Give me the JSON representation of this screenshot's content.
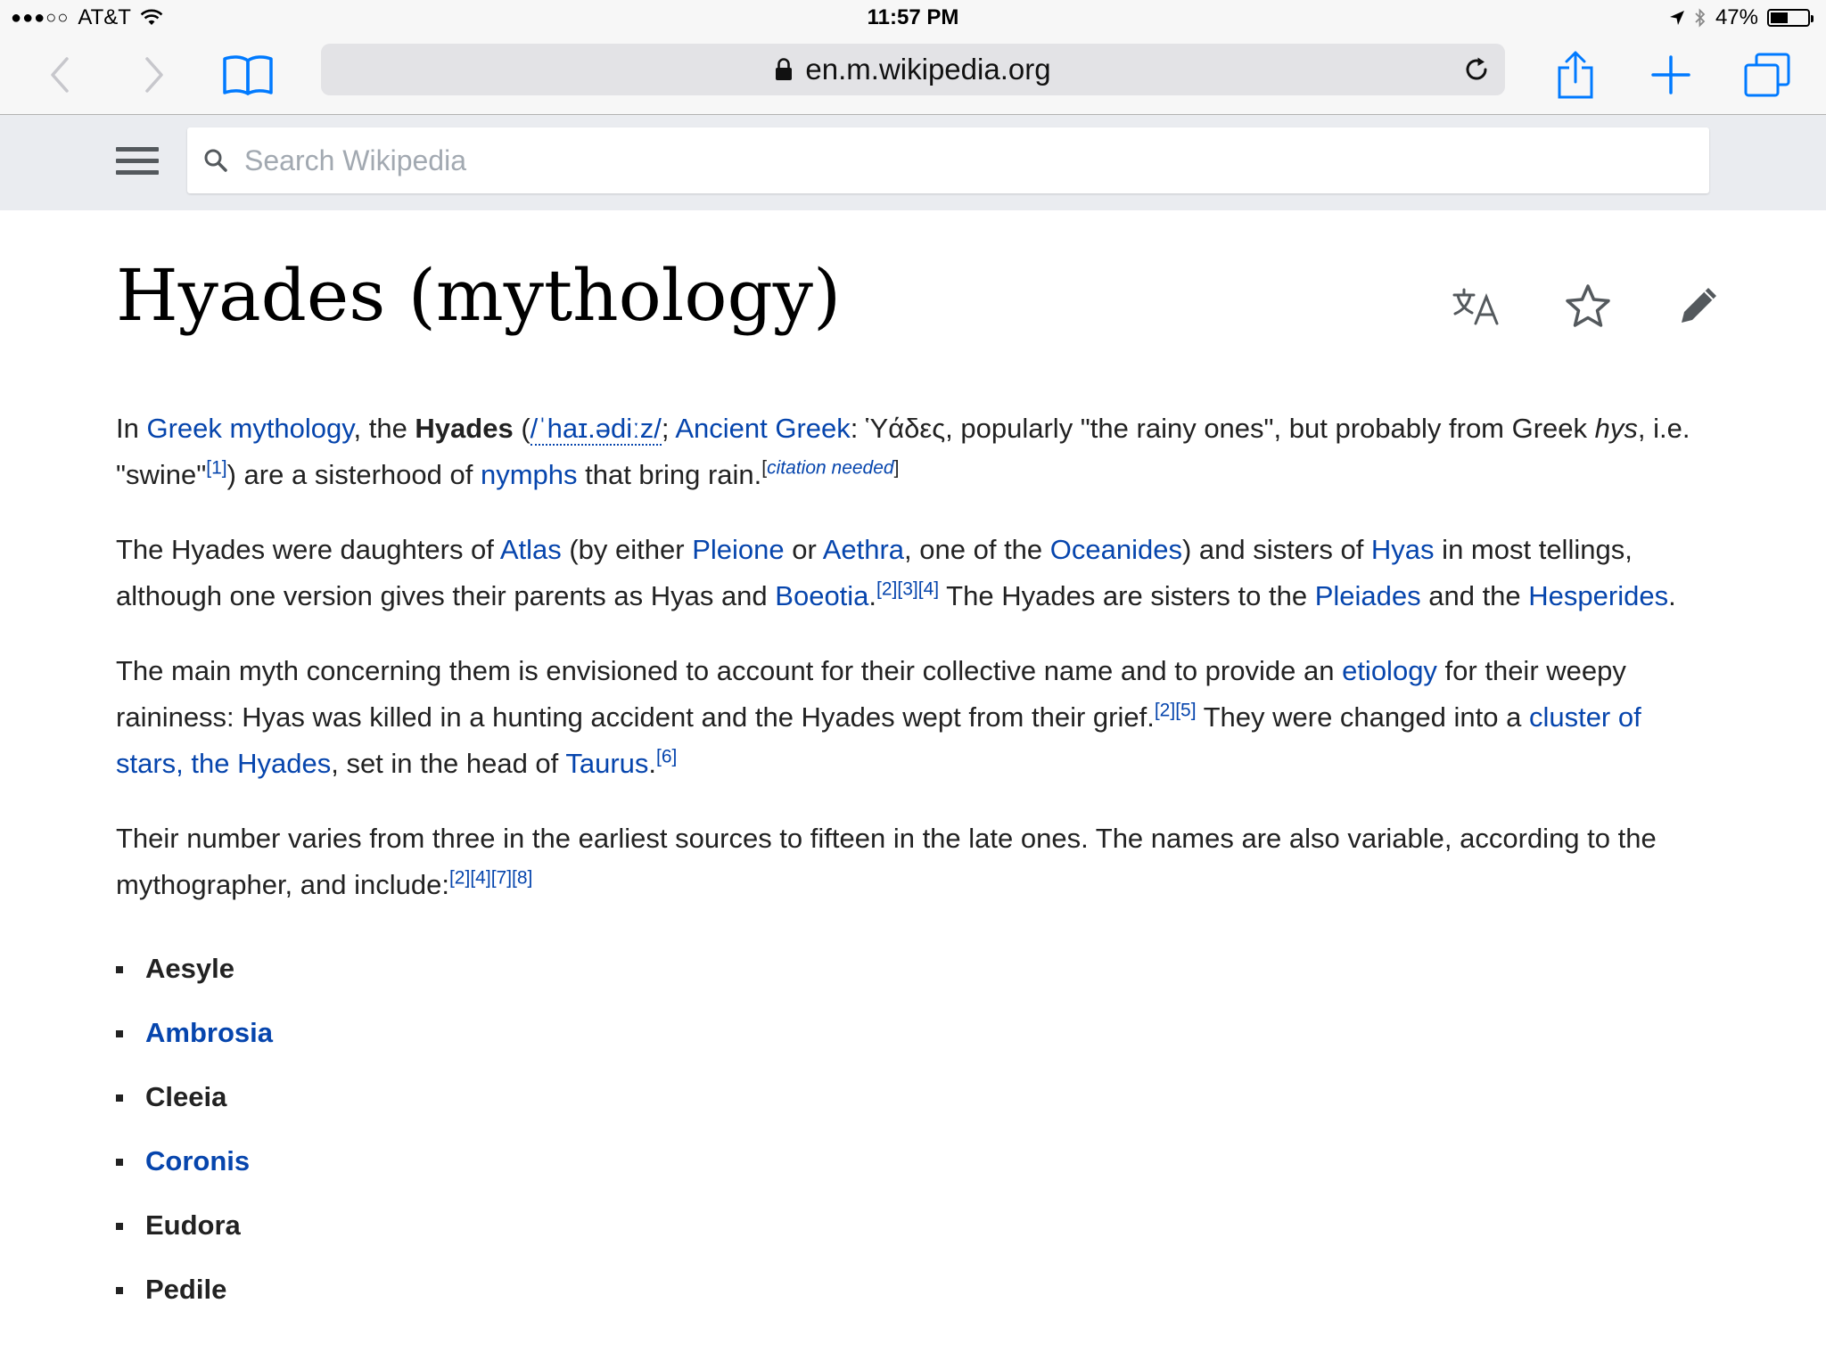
{
  "status_bar": {
    "signal": "●●●○○",
    "carrier": "AT&T",
    "time": "11:57 PM",
    "battery_text": "47%",
    "battery_level": 0.47
  },
  "browser": {
    "url": "en.m.wikipedia.org"
  },
  "wiki": {
    "search_placeholder": "Search Wikipedia"
  },
  "article": {
    "title": "Hyades (mythology)",
    "p1": {
      "t1": "In ",
      "link_greek_mythology": "Greek mythology",
      "t2": ", the ",
      "bold_hyades": "Hyades",
      "t3": " (",
      "ipa": "/ˈhaɪ.ədiːz/",
      "t4": "; ",
      "link_ancient_greek": "Ancient Greek",
      "t5": ": Ὑάδες, popularly \"the rainy ones\", but probably from Greek ",
      "italic_hys": "hys",
      "t6": ", i.e. \"swine\"",
      "ref1": "[1]",
      "t7": ") are a sisterhood of ",
      "link_nymphs": "nymphs",
      "t8": " that bring rain.",
      "cn_open": "[",
      "cn_text": "citation needed",
      "cn_close": "]"
    },
    "p2": {
      "t1": "The Hyades were daughters of ",
      "link_atlas": "Atlas",
      "t2": " (by either ",
      "link_pleione": "Pleione",
      "t3": " or ",
      "link_aethra": "Aethra",
      "t4": ", one of the ",
      "link_oceanides": "Oceanides",
      "t5": ") and sisters of ",
      "link_hyas": "Hyas",
      "t6": " in most tellings, although one version gives their parents as Hyas and ",
      "link_boeotia": "Boeotia",
      "t7": ".",
      "ref2": "[2]",
      "ref3": "[3]",
      "ref4": "[4]",
      "t8": " The Hyades are sisters to the ",
      "link_pleiades": "Pleiades",
      "t9": " and the ",
      "link_hesperides": "Hesperides",
      "t10": "."
    },
    "p3": {
      "t1": "The main myth concerning them is envisioned to account for their collective name and to provide an ",
      "link_etiology": "etiology",
      "t2": " for their weepy raininess: Hyas was killed in a hunting accident and the Hyades wept from their grief.",
      "ref2": "[2]",
      "ref5": "[5]",
      "t3": " They were changed into a ",
      "link_cluster": "cluster of stars, the Hyades",
      "t4": ", set in the head of ",
      "link_taurus": "Taurus",
      "t5": ".",
      "ref6": "[6]"
    },
    "p4": {
      "t1": "Their number varies from three in the earliest sources to fifteen in the late ones. The names are also variable, according to the mythographer, and include:",
      "ref2": "[2]",
      "ref4": "[4]",
      "ref7": "[7]",
      "ref8": "[8]"
    },
    "names": [
      "Aesyle",
      "Ambrosia",
      "Cleeia",
      "Coronis",
      "Eudora",
      "Pedile"
    ]
  },
  "colors": {
    "link": "#0645ad",
    "text": "#222222",
    "ios_blue": "#007aff",
    "header_bg": "#eaecf0"
  },
  "icons": {
    "back": "chevron-left-icon",
    "forward": "chevron-right-icon",
    "bookmarks": "book-icon",
    "lock": "lock-icon",
    "reload": "reload-icon",
    "share": "share-icon",
    "new_tab": "plus-icon",
    "tabs": "tabs-icon",
    "menu": "hamburger-icon",
    "search": "search-icon",
    "language": "translate-icon",
    "watch": "star-icon",
    "edit": "pencil-icon"
  }
}
